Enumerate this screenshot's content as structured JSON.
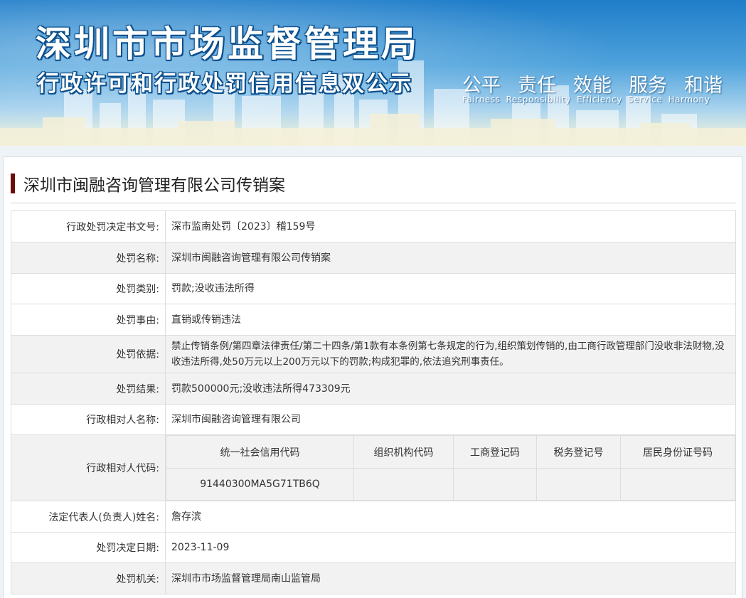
{
  "banner": {
    "title": "深圳市市场监督管理局",
    "subtitle": "行政许可和行政处罚信用信息双公示",
    "slogans_cn": [
      "公平",
      "责任",
      "效能",
      "服务",
      "和谐"
    ],
    "slogans_en": [
      "Fairness",
      "Responsibility",
      "Efficiency",
      "Service",
      "Harmony"
    ]
  },
  "case": {
    "title": "深圳市闽融咨询管理有限公司传销案"
  },
  "fields": {
    "doc_no_label": "行政处罚决定书文号:",
    "doc_no": "深市监南处罚〔2023〕稽159号",
    "name_label": "处罚名称:",
    "name": "深圳市闽融咨询管理有限公司传销案",
    "category_label": "处罚类别:",
    "category": "罚款;没收违法所得",
    "reason_label": "处罚事由:",
    "reason": "直销或传销违法",
    "basis_label": "处罚依据:",
    "basis": "禁止传销条例/第四章法律责任/第二十四条/第1款有本条例第七条规定的行为,组织策划传销的,由工商行政管理部门没收非法财物,没收违法所得,处50万元以上200万元以下的罚款;构成犯罪的,依法追究刑事责任。",
    "result_label": "处罚结果:",
    "result": "罚款500000元;没收违法所得473309元",
    "party_label": "行政相对人名称:",
    "party": "深圳市闽融咨询管理有限公司",
    "party_code_label": "行政相对人代码:",
    "codes": {
      "headers": [
        "统一社会信用代码",
        "组织机构代码",
        "工商登记码",
        "税务登记号",
        "居民身份证号码"
      ],
      "values": [
        "91440300MA5G71TB6Q",
        "",
        "",
        "",
        ""
      ]
    },
    "legal_rep_label": "法定代表人(负责人)姓名:",
    "legal_rep": "詹存滨",
    "date_label": "处罚决定日期:",
    "date": "2023-11-09",
    "authority_label": "处罚机关:",
    "authority": "深圳市市场监督管理局南山监管局"
  }
}
